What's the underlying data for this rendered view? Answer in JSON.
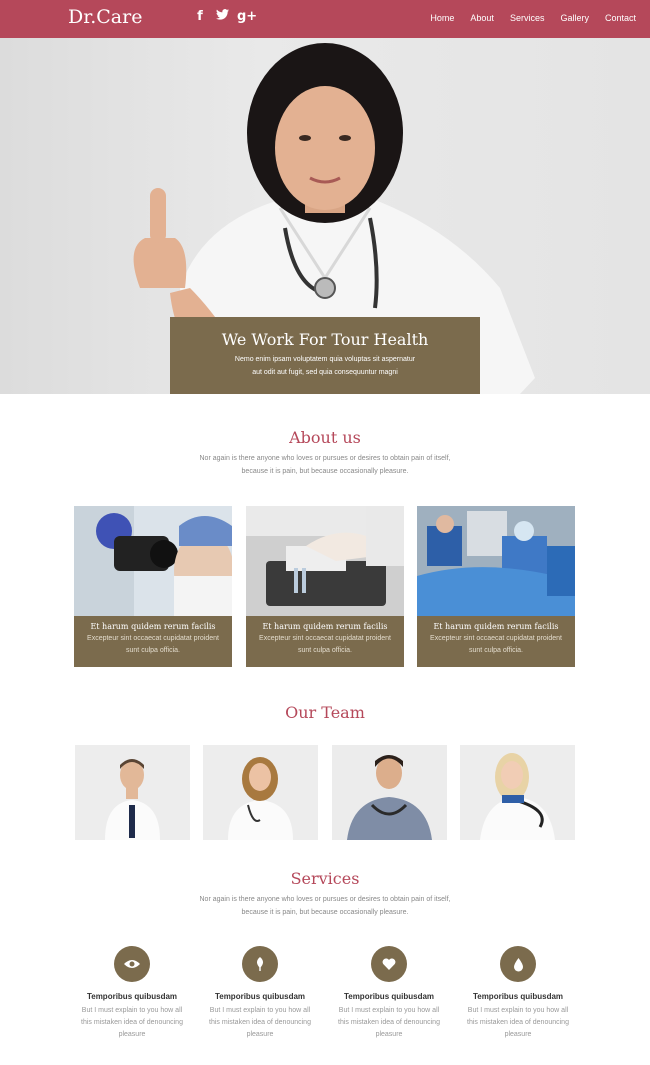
{
  "header": {
    "brand": "Dr.Care",
    "social": [
      {
        "icon": "facebook-icon",
        "glyph": "f"
      },
      {
        "icon": "twitter-icon",
        "glyph": "t"
      },
      {
        "icon": "google-plus-icon",
        "glyph": "g+"
      }
    ],
    "nav": [
      "Home",
      "About",
      "Services",
      "Gallery",
      "Contact"
    ]
  },
  "hero": {
    "title": "We Work For Tour Health",
    "line1": "Nemo enim ipsam voluptatem quia voluptas sit aspernatur",
    "line2": "aut odit aut fugit, sed quia consequuntur magni"
  },
  "about": {
    "title": "About us",
    "line1": "Nor again is there anyone who loves or pursues or desires to obtain pain of itself,",
    "line2": "because it is pain, but because occasionally pleasure.",
    "cards": [
      {
        "title": "Et harum quidem rerum facilis",
        "line1": "Excepteur sint occaecat cupidatat proident",
        "line2": "sunt culpa officia."
      },
      {
        "title": "Et harum quidem rerum facilis",
        "line1": "Excepteur sint occaecat cupidatat proident",
        "line2": "sunt culpa officia."
      },
      {
        "title": "Et harum quidem rerum facilis",
        "line1": "Excepteur sint occaecat cupidatat proident",
        "line2": "sunt culpa officia."
      }
    ]
  },
  "team": {
    "title": "Our Team"
  },
  "services": {
    "title": "Services",
    "line1": "Nor again is there anyone who loves or pursues or desires to obtain pain of itself,",
    "line2": "because it is pain, but because occasionally pleasure.",
    "items": [
      {
        "icon": "eye-icon",
        "title": "Temporibus quibusdam",
        "line1": "But I must explain to you how all",
        "line2": "this mistaken idea of denouncing",
        "line3": "pleasure"
      },
      {
        "icon": "leaf-icon",
        "title": "Temporibus quibusdam",
        "line1": "But I must explain to you how all",
        "line2": "this mistaken idea of denouncing",
        "line3": "pleasure"
      },
      {
        "icon": "heart-icon",
        "title": "Temporibus quibusdam",
        "line1": "But I must explain to you how all",
        "line2": "this mistaken idea of denouncing",
        "line3": "pleasure"
      },
      {
        "icon": "drop-icon",
        "title": "Temporibus quibusdam",
        "line1": "But I must explain to you how all",
        "line2": "this mistaken idea of denouncing",
        "line3": "pleasure"
      }
    ]
  },
  "colors": {
    "header": "#b5485a",
    "accent": "#7b6b4d"
  }
}
